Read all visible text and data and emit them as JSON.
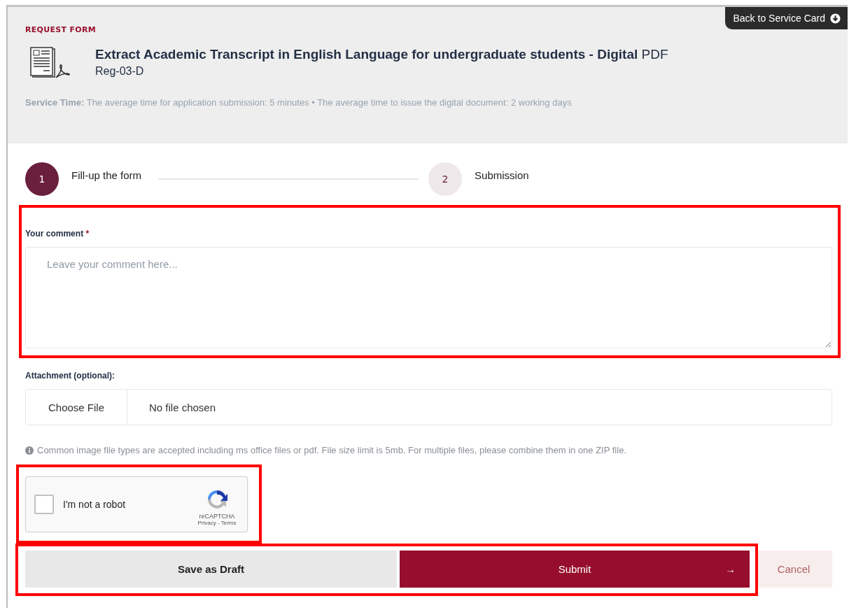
{
  "header": {
    "eyebrow": "REQUEST FORM",
    "back_button": "Back to Service Card",
    "title": "**Extract Academic Transcript in English Language for undergraduate students - Digital** PDF",
    "code": "Reg-03-D",
    "service_time": "**Service Time:** The average time for application submission: 5 minutes • The average time to issue the digital document: 2 working days"
  },
  "steps": [
    {
      "number": "1",
      "label": "Fill-up the form",
      "selected": true
    },
    {
      "number": "2",
      "label": "Submission",
      "selected": false
    }
  ],
  "comment": {
    "label": "Your comment",
    "required_mark": "*",
    "placeholder": "Leave your comment here...",
    "highlighted": true
  },
  "attachment": {
    "label": "Attachment (optional):",
    "choose_button": "Choose File",
    "status": "No file chosen",
    "hint": "Common image file types are accepted including ms office files or pdf. File size limit is 5mb. For multiple files, please combine them in one ZIP file."
  },
  "captcha": {
    "label": "I'm not a robot",
    "checked": false,
    "brand": "reCAPTCHA",
    "privacy": "Privacy",
    "separator": "-",
    "terms": "Terms",
    "highlighted": true
  },
  "actions": {
    "draft": "Save as Draft",
    "submit": "Submit",
    "submit_arrow": "→",
    "cancel": "Cancel",
    "highlighted": true
  }
}
